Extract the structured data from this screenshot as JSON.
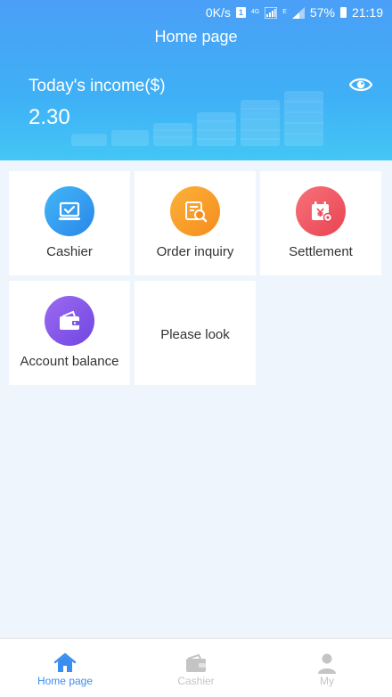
{
  "status_bar": {
    "network_speed": "0K/s",
    "notification_badge": "1",
    "network_type": "4G",
    "signal2_label": "E",
    "battery": "57%",
    "time": "21:19"
  },
  "header": {
    "title": "Home page",
    "income_label": "Today's income($)",
    "income_value": "2.30",
    "eye_icon": "eye-icon"
  },
  "grid": {
    "items": [
      {
        "label": "Cashier",
        "icon": "laptop-check-icon",
        "color": "#2f95ec"
      },
      {
        "label": "Order inquiry",
        "icon": "order-search-icon",
        "color": "#f8a12a"
      },
      {
        "label": "Settlement",
        "icon": "calendar-yen-icon",
        "color": "#ef5861"
      },
      {
        "label": "Account balance",
        "icon": "wallet-icon",
        "color": "#8357ea"
      },
      {
        "label": "Please look"
      }
    ]
  },
  "bottom_nav": {
    "items": [
      {
        "label": "Home page",
        "icon": "home-icon",
        "active": true
      },
      {
        "label": "Cashier",
        "icon": "wallet-icon",
        "active": false
      },
      {
        "label": "My",
        "icon": "person-icon",
        "active": false
      }
    ],
    "active_color": "#3a8ef0",
    "inactive_color": "#c4c4c4"
  }
}
